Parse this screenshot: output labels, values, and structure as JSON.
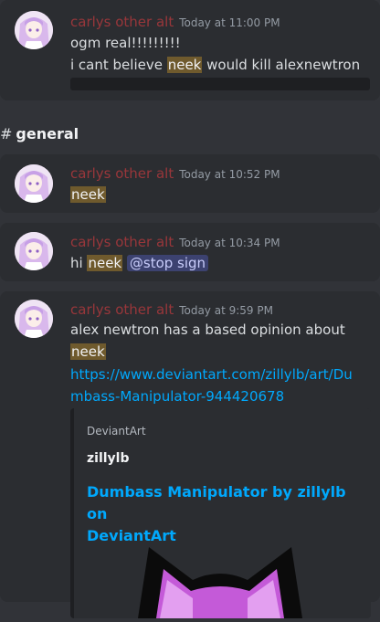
{
  "messages": [
    {
      "author": "carlys other alt",
      "timestamp": "Today at 11:00 PM",
      "line1": "ogm real!!!!!!!!!",
      "line2_pre": "i cant believe ",
      "line2_hl": "neek",
      "line2_post": " would kill alexnewtron"
    },
    {
      "author": "carlys other alt",
      "timestamp": "Today at 10:52 PM",
      "hl": "neek"
    },
    {
      "author": "carlys other alt",
      "timestamp": "Today at 10:34 PM",
      "pre": "hi ",
      "hl": "neek",
      "mention": "@stop sign"
    },
    {
      "author": "carlys other alt",
      "timestamp": "Today at 9:59 PM",
      "line1": "alex newtron has a based opinion about",
      "hl": "neek",
      "link_line1": "https://www.deviantart.com/zillylb/art/Du",
      "link_line2": "mbass-Manipulator-944420678",
      "embed": {
        "provider": "DeviantArt",
        "author": "zillylb",
        "title_line1": "Dumbass Manipulator by zillylb on",
        "title_line2": "DeviantArt"
      }
    }
  ],
  "channel": {
    "hash": "#",
    "name": "general"
  },
  "icons": {
    "avatar": "anime-avatar-icon",
    "channel": "hash-icon"
  },
  "colors": {
    "background": "#313338",
    "card": "#2b2d31",
    "author": "#f23f43",
    "link": "#00a8fc",
    "highlight": "#6f5a2d",
    "mention": "#3c4270"
  }
}
